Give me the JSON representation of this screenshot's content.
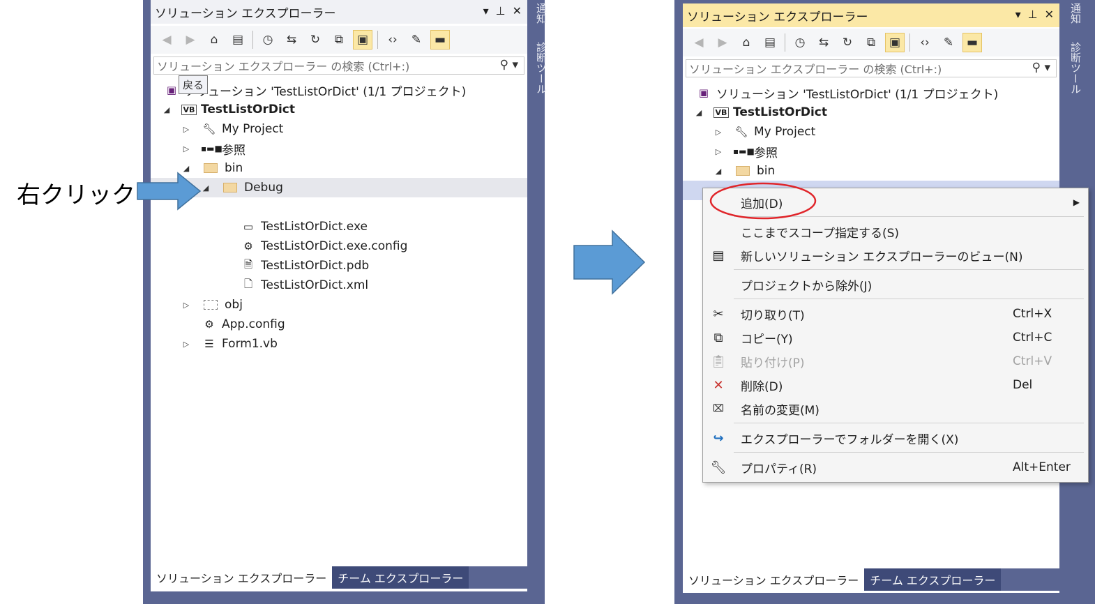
{
  "annotation": {
    "right_click_label": "右クリック"
  },
  "panel": {
    "title": "ソリューション エクスプローラー",
    "search_placeholder": "ソリューション エクスプローラー の検索 (Ctrl+:)",
    "tooltip": "戻る",
    "tabs": [
      "ソリューション エクスプローラー",
      "チーム エクスプローラー"
    ],
    "side_vertical_1": "通知",
    "side_vertical_2": "診断ツール"
  },
  "tree": {
    "solution": "ソリューション 'TestListOrDict' (1/1 プロジェクト)",
    "project": "TestListOrDict",
    "my_project": "My Project",
    "references": "参照",
    "bin": "bin",
    "debug": "Debug",
    "files": [
      "TestListOrDict.exe",
      "TestListOrDict.exe.config",
      "TestListOrDict.pdb",
      "TestListOrDict.xml"
    ],
    "obj": "obj",
    "app_config": "App.config",
    "form1": "Form1.vb"
  },
  "context_menu": {
    "items": [
      {
        "label": "追加(D)",
        "shortcut": "",
        "icon": "none",
        "submenu": true
      },
      {
        "label": "ここまでスコープ指定する(S)",
        "shortcut": "",
        "icon": "none"
      },
      {
        "label": "新しいソリューション エクスプローラーのビュー(N)",
        "shortcut": "",
        "icon": "new-view-icon"
      },
      {
        "label": "プロジェクトから除外(J)",
        "shortcut": "",
        "icon": "none"
      },
      {
        "label": "切り取り(T)",
        "shortcut": "Ctrl+X",
        "icon": "cut-icon"
      },
      {
        "label": "コピー(Y)",
        "shortcut": "Ctrl+C",
        "icon": "copy-icon"
      },
      {
        "label": "貼り付け(P)",
        "shortcut": "Ctrl+V",
        "icon": "paste-icon",
        "disabled": true
      },
      {
        "label": "削除(D)",
        "shortcut": "Del",
        "icon": "delete-icon"
      },
      {
        "label": "名前の変更(M)",
        "shortcut": "",
        "icon": "rename-icon"
      },
      {
        "label": "エクスプローラーでフォルダーを開く(X)",
        "shortcut": "",
        "icon": "open-folder-icon"
      },
      {
        "label": "プロパティ(R)",
        "shortcut": "Alt+Enter",
        "icon": "wrench-icon"
      }
    ]
  },
  "colors": {
    "frame": "#5a6592",
    "title_active": "#fbe8a6",
    "arrow_fill": "#5b9bd5",
    "highlight_ellipse": "#e0252a",
    "delete_icon": "#c8312d",
    "open_folder_icon": "#1f6fbf"
  }
}
